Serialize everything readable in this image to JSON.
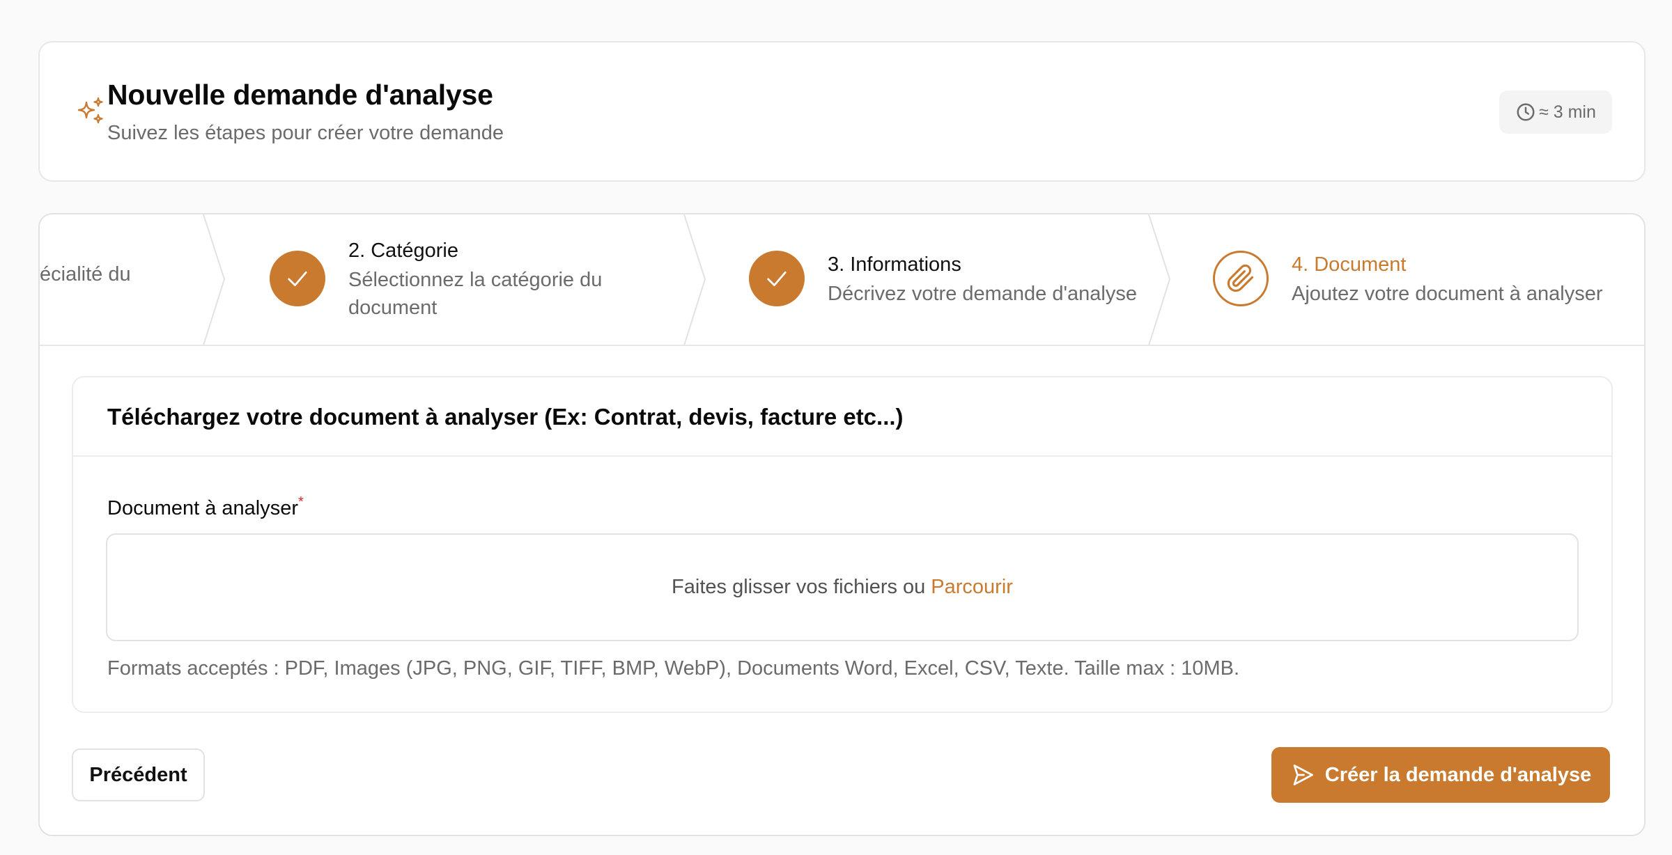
{
  "header": {
    "title": "Nouvelle demande d'analyse",
    "subtitle": "Suivez les étapes pour créer votre demande",
    "time_estimate": "≈ 3 min",
    "icon": "sparkles-icon"
  },
  "stepper": {
    "partial_step_text": "écialité du",
    "steps": [
      {
        "title": "2. Catégorie",
        "description": "Sélectionnez la catégorie du document",
        "status": "done"
      },
      {
        "title": "3. Informations",
        "description": "Décrivez votre demande d'analyse",
        "status": "done"
      },
      {
        "title": "4. Document",
        "description": "Ajoutez votre document à analyser",
        "status": "current"
      }
    ]
  },
  "upload": {
    "card_title": "Téléchargez votre document à analyser (Ex: Contrat, devis, facture etc...)",
    "field_label": "Document à analyser",
    "required_mark": "*",
    "dropzone_text": "Faites glisser vos fichiers ou",
    "browse_label": "Parcourir",
    "hint": "Formats acceptés : PDF, Images (JPG, PNG, GIF, TIFF, BMP, WebP), Documents Word, Excel, CSV, Texte. Taille max : 10MB."
  },
  "actions": {
    "previous_label": "Précédent",
    "create_label": "Créer la demande d'analyse"
  },
  "colors": {
    "accent": "#c97a2e",
    "background": "#fafafa",
    "border": "#e2e2e2",
    "muted_text": "#6b6b6b",
    "required": "#dc2626"
  }
}
